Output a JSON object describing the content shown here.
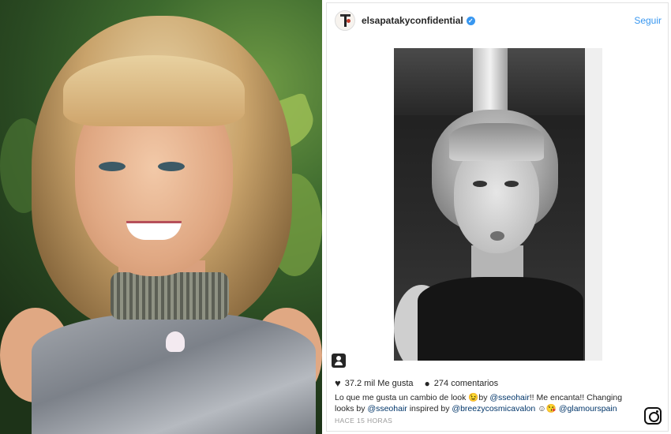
{
  "post": {
    "username": "elsapatakyconfidential",
    "follow_label": "Seguir",
    "likes": "37.2 mil Me gusta",
    "comments": "274 comentarios",
    "caption": {
      "part1": "Lo que me gusta un cambio de look ",
      "emoji1": "😉",
      "by1": "by ",
      "mention1": "@sseohair",
      "part2": "!! Me encanta!! Changing looks by ",
      "mention2": "@sseohair",
      "part3": " inspired by ",
      "mention3": "@breezycosmicavalon",
      "emoji2": " ☺😘 ",
      "mention4": "@glamourspain"
    },
    "time": "HACE 15 HORAS"
  },
  "icons": {
    "verified": "verified-badge-icon",
    "heart": "heart-icon",
    "comment": "comment-icon",
    "tag": "user-tag-icon",
    "instagram": "instagram-logo-icon"
  },
  "colors": {
    "link": "#3897f0",
    "mention": "#003569",
    "text": "#262626",
    "muted": "#999999"
  }
}
